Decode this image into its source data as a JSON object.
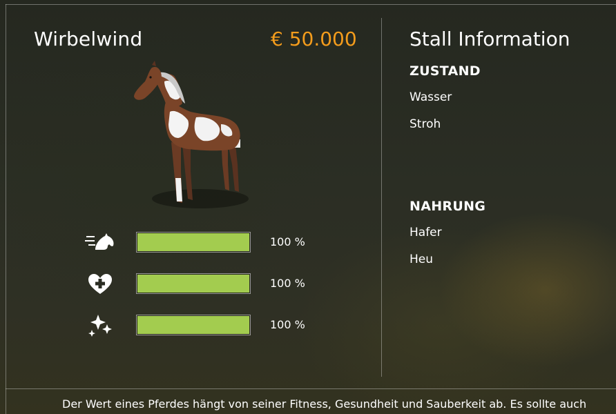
{
  "horse": {
    "name": "Wirbelwind",
    "price": "€ 50.000"
  },
  "stats": [
    {
      "icon": "fitness-icon",
      "fill": 1.0,
      "label": "100 %"
    },
    {
      "icon": "health-icon",
      "fill": 1.0,
      "label": "100 %"
    },
    {
      "icon": "cleanliness-icon",
      "fill": 1.0,
      "label": "100 %"
    }
  ],
  "stall": {
    "title": "Stall Information",
    "condition_header": "ZUSTAND",
    "condition_items": [
      "Wasser",
      "Stroh"
    ],
    "food_header": "NAHRUNG",
    "food_items": [
      "Hafer",
      "Heu"
    ]
  },
  "footer": {
    "text": "Der Wert eines Pferdes hängt von seiner Fitness, Gesundheit und Sauberkeit ab. Es sollte auch"
  },
  "colors": {
    "price": "#f39c1c",
    "bar_fill": "#a3cc4f"
  }
}
